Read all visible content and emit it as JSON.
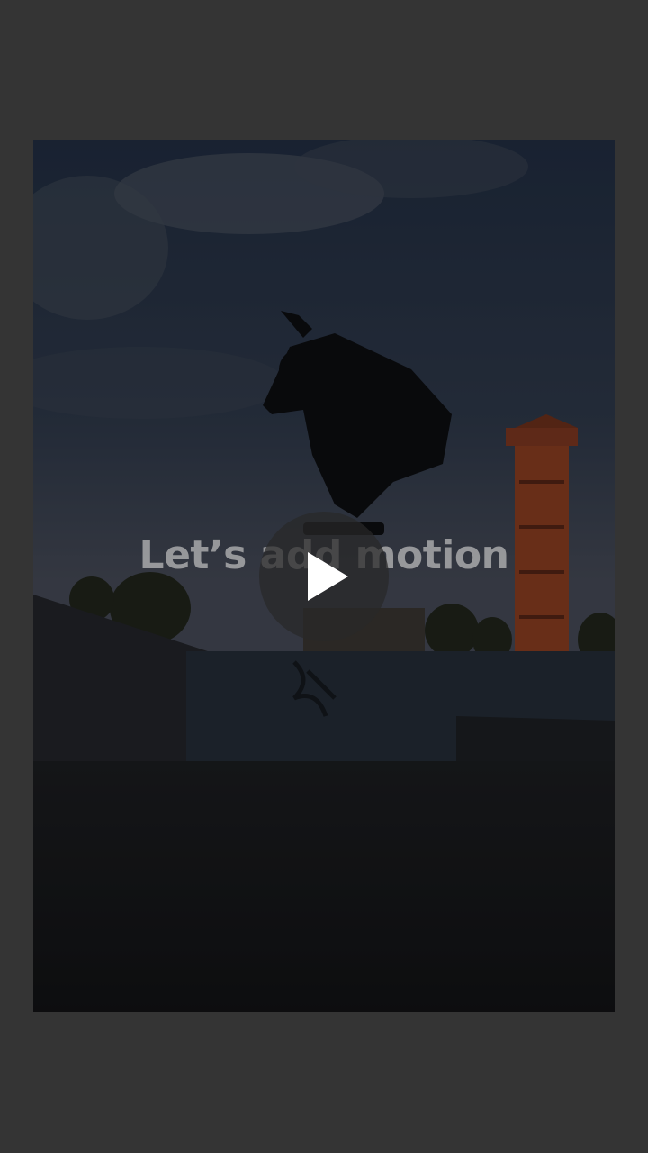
{
  "screen": {
    "background_color": "#343434"
  },
  "video": {
    "overlay_title": "Let’s add motion",
    "play_icon": "play-icon",
    "scene": "skateboarder-jumping-at-skatepark"
  }
}
